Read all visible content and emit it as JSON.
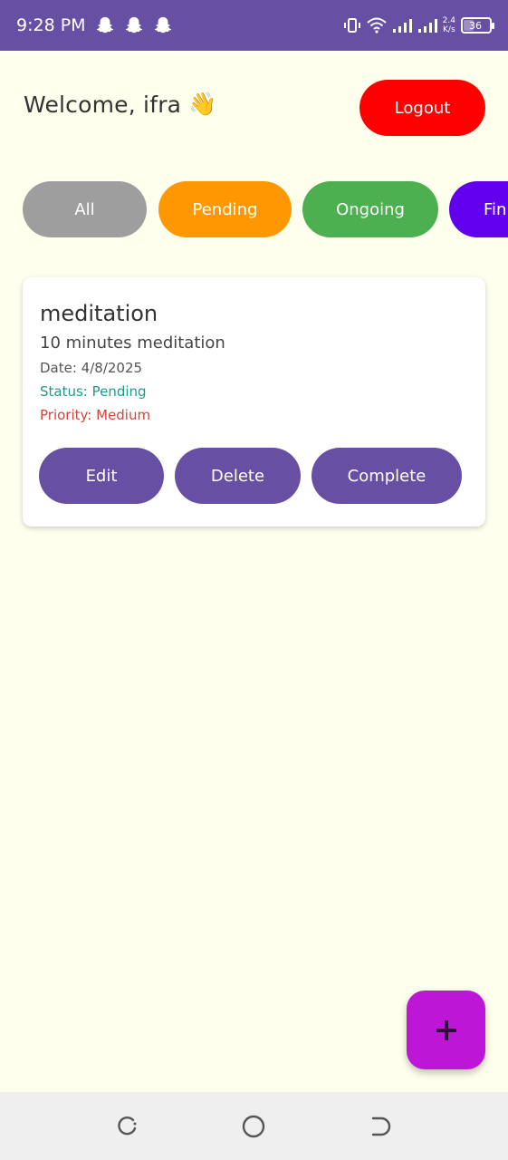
{
  "status_bar": {
    "time": "9:28 PM",
    "net_speed_value": "2.4",
    "net_speed_unit": "K/s",
    "battery": "36",
    "battery_fraction": 0.36,
    "icons": [
      "snapchat-ghost-icon",
      "snapchat-ghost-icon",
      "snapchat-ghost-icon",
      "vibrate-icon",
      "wifi-icon",
      "signal-icon",
      "signal-icon",
      "battery-icon"
    ]
  },
  "header": {
    "welcome": "Welcome, ifra",
    "welcome_emoji": "👋",
    "logout_label": "Logout"
  },
  "filters": [
    {
      "label": "All",
      "color": "#9E9E9E"
    },
    {
      "label": "Pending",
      "color": "#FF9800"
    },
    {
      "label": "Ongoing",
      "color": "#4CAF50"
    },
    {
      "label": "Fin",
      "color": "#6200EE"
    }
  ],
  "task": {
    "title": "meditation",
    "description": "10 minutes meditation",
    "date": "Date: 4/8/2025",
    "status": "Status: Pending",
    "priority": "Priority: Medium",
    "actions": {
      "edit": "Edit",
      "delete": "Delete",
      "complete": "Complete"
    }
  },
  "fab": {
    "icon": "plus-icon",
    "color": "#BE16D6"
  },
  "colors": {
    "primary": "#6750A4",
    "background": "#FFFFEE",
    "logout": "#FF0000",
    "status_text": "#1E9A8C",
    "priority_text": "#D0463A"
  }
}
